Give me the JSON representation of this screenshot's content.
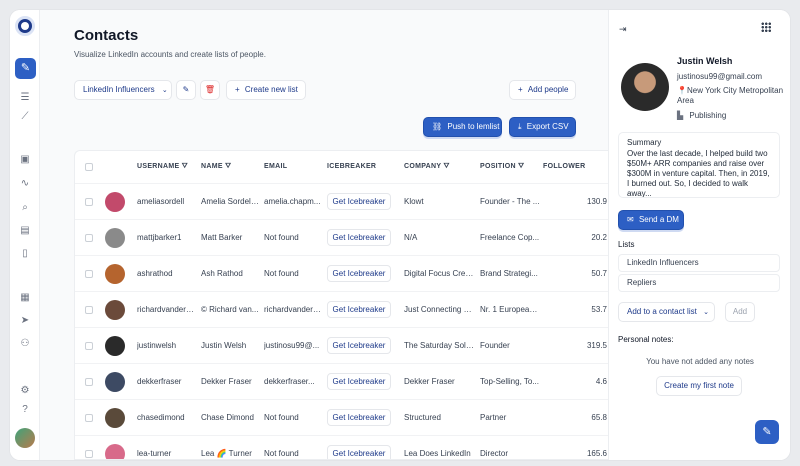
{
  "page": {
    "title": "Contacts",
    "subtitle": "Visualize LinkedIn accounts and create lists of people."
  },
  "toolbar": {
    "list_select": "LinkedIn Influencers",
    "create_list": "Create new list",
    "add_people": "Add people",
    "push_lemlist": "Push to lemlist",
    "export_csv": "Export CSV"
  },
  "table": {
    "headers": [
      "USERNAME",
      "NAME",
      "EMAIL",
      "ICEBREAKER",
      "COMPANY",
      "POSITION",
      "FOLLOWER"
    ],
    "icebreaker_label": "Get Icebreaker",
    "rows": [
      {
        "username": "ameliasordell",
        "name": "Amelia Sordell...",
        "email": "amelia.chapm...",
        "company": "Klowt",
        "position": "Founder - The ...",
        "followers": "130.9",
        "avatar_color": "#c24a6b"
      },
      {
        "username": "mattjbarker1",
        "name": "Matt Barker",
        "email": "Not found",
        "company": "N/A",
        "position": "Freelance Cop...",
        "followers": "20.2",
        "avatar_color": "#8a8a8a"
      },
      {
        "username": "ashrathod",
        "name": "Ash Rathod",
        "email": "Not found",
        "company": "Digital Focus Creat...",
        "position": "Brand Strategi...",
        "followers": "50.7",
        "avatar_color": "#b5642e"
      },
      {
        "username": "richardvanderb...",
        "name": "© Richard van...",
        "email": "richardvanderb...",
        "company": "Just Connecting B....",
        "position": "Nr. 1 European...",
        "followers": "53.7",
        "avatar_color": "#6b4a3a"
      },
      {
        "username": "justinwelsh",
        "name": "Justin Welsh",
        "email": "justinosu99@...",
        "company": "The Saturday Solo...",
        "position": "Founder",
        "followers": "319.5",
        "avatar_color": "#2a2a2a"
      },
      {
        "username": "dekkerfraser",
        "name": "Dekker Fraser",
        "email": "dekkerfraser...",
        "company": "Dekker Fraser",
        "position": "Top-Selling, To...",
        "followers": "4.6",
        "avatar_color": "#3d4a63"
      },
      {
        "username": "chasedimond",
        "name": "Chase Dimond",
        "email": "Not found",
        "company": "Structured",
        "position": "Partner",
        "followers": "65.8",
        "avatar_color": "#5a4a3a"
      },
      {
        "username": "lea-turner",
        "name": "Lea 🌈 Turner",
        "email": "Not found",
        "company": "Lea Does LinkedIn",
        "position": "Director",
        "followers": "165.6",
        "avatar_color": "#d86a8a"
      }
    ]
  },
  "panel": {
    "name": "Justin Welsh",
    "email": "justinosu99@gmail.com",
    "location": "New York City Metropolitan Area",
    "industry": "Publishing",
    "summary_heading": "Summary",
    "summary_text": "Over the last decade, I helped build two $50M+ ARR companies and raise over $300M in venture capital. Then, in 2019, I burned out. So, I decided to walk away...",
    "send_dm": "Send a DM",
    "lists_label": "Lists",
    "lists": [
      "LinkedIn Influencers",
      "Repliers"
    ],
    "add_to_list": "Add to a contact list",
    "add_button": "Add",
    "notes_label": "Personal notes:",
    "notes_empty": "You have not added any notes",
    "create_note": "Create my first note"
  }
}
